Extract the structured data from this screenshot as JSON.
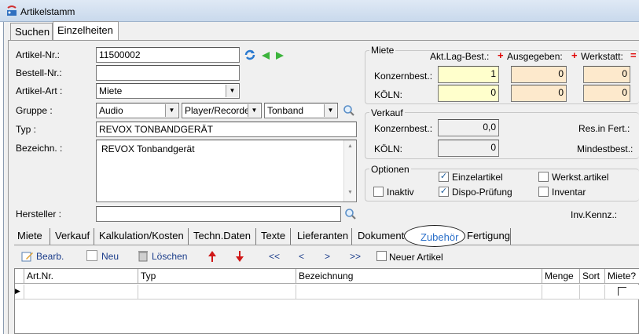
{
  "window": {
    "title": "Artikelstamm"
  },
  "top_tabs": [
    "Suchen",
    "Einzelheiten"
  ],
  "form": {
    "artikel_nr_label": "Artikel-Nr.:",
    "artikel_nr_value": "11500002",
    "bestell_nr_label": "Bestell-Nr.:",
    "bestell_nr_value": "",
    "artikel_art_label": "Artikel-Art :",
    "artikel_art_value": "Miete",
    "gruppe_label": "Gruppe :",
    "gruppe_value1": "Audio",
    "gruppe_value2": "Player/Recorde",
    "gruppe_value3": "Tonband",
    "typ_label": "Typ :",
    "typ_value": "REVOX TONBANDGERÄT",
    "bezeichn_label": "Bezeichn. :",
    "bezeichn_value": "REVOX  Tonbandgerät",
    "hersteller_label": "Hersteller :",
    "hersteller_value": ""
  },
  "miete": {
    "title": "Miete",
    "col_akt": "Akt.Lag-Best.:",
    "col_ausg": "Ausgegeben:",
    "col_werk": "Werkstatt:",
    "plus": "+",
    "eq": "=",
    "row1_label": "Konzernbest.:",
    "row1_values": [
      "1",
      "0",
      "0"
    ],
    "row2_label": "KÖLN:",
    "row2_values": [
      "0",
      "0",
      "0"
    ]
  },
  "verkauf": {
    "title": "Verkauf",
    "row1_label": "Konzernbest.:",
    "row1_value": "0,0",
    "row2_label": "KÖLN:",
    "row2_value": "0",
    "res_label": "Res.in Fert.:",
    "mindest_label": "Mindestbest.:"
  },
  "optionen": {
    "title": "Optionen",
    "einzelartikel": "Einzelartikel",
    "werkst_artikel": "Werkst.artikel",
    "inaktiv": "Inaktiv",
    "dispo": "Dispo-Prüfung",
    "inventar": "Inventar",
    "check": "✓"
  },
  "inv_kennz_label": "Inv.Kennz.:",
  "sub_tabs": [
    "Miete",
    "Verkauf",
    "Kalkulation/Kosten",
    "Techn.Daten",
    "Texte",
    "Lieferanten",
    "Dokumente",
    "Zubehör",
    "Fertigung"
  ],
  "toolbar": {
    "bearb": "Bearb.",
    "neu": "Neu",
    "loeschen": "Löschen",
    "first": "<<",
    "prev": "<",
    "next": ">",
    "last": ">>",
    "neuer_artikel": "Neuer Artikel"
  },
  "grid": {
    "columns": [
      "Art.Nr.",
      "Typ",
      "Bezeichnung",
      "Menge",
      "Sort",
      "Miete?"
    ],
    "row_marker": "▶"
  }
}
